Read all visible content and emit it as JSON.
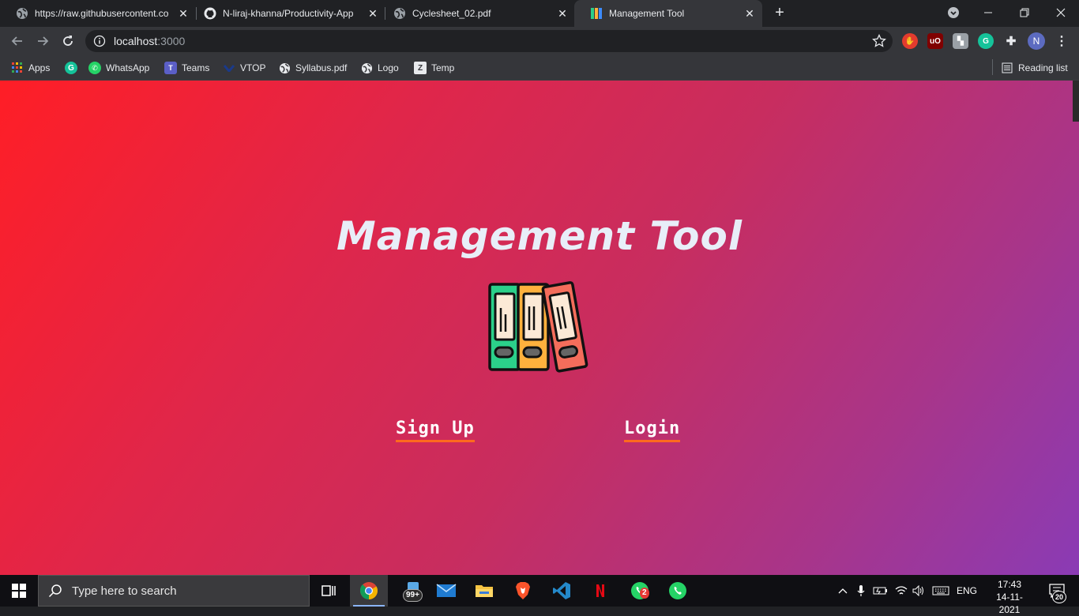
{
  "browser": {
    "tabs": [
      {
        "title": "https://raw.githubusercontent.co",
        "active": false
      },
      {
        "title": "N-liraj-khanna/Productivity-App",
        "active": false
      },
      {
        "title": "Cyclesheet_02.pdf",
        "active": false
      },
      {
        "title": "Management Tool",
        "active": true
      }
    ],
    "address": {
      "host": "localhost",
      "port": ":3000"
    },
    "extensions": [
      "stop-hand-icon",
      "ublock-icon",
      "puzzle-ext-icon",
      "grammarly-icon",
      "extensions-icon",
      "profile-avatar"
    ],
    "profile_initial": "N",
    "bookmarks": [
      {
        "label": "Apps",
        "icon": "apps-grid-icon"
      },
      {
        "label": "",
        "icon": "grammarly-icon"
      },
      {
        "label": "WhatsApp",
        "icon": "whatsapp-icon"
      },
      {
        "label": "Teams",
        "icon": "teams-icon"
      },
      {
        "label": "VTOP",
        "icon": "vtop-icon"
      },
      {
        "label": "Syllabus.pdf",
        "icon": "globe-icon"
      },
      {
        "label": "Logo",
        "icon": "globe-icon"
      },
      {
        "label": "Temp",
        "icon": "temp-icon"
      }
    ],
    "reading_list": "Reading list"
  },
  "page": {
    "title": "Management Tool",
    "signup": "Sign Up",
    "login": "Login",
    "accent": "#ff6a1e",
    "gradient": [
      "#ff1e26",
      "#8a3bb5"
    ]
  },
  "taskbar": {
    "search_placeholder": "Type here to search",
    "mail_badge": "99+",
    "whatsapp_badge": "2",
    "language": "ENG",
    "time": "17:43",
    "date": "14-11-2021",
    "notifications": "20"
  }
}
